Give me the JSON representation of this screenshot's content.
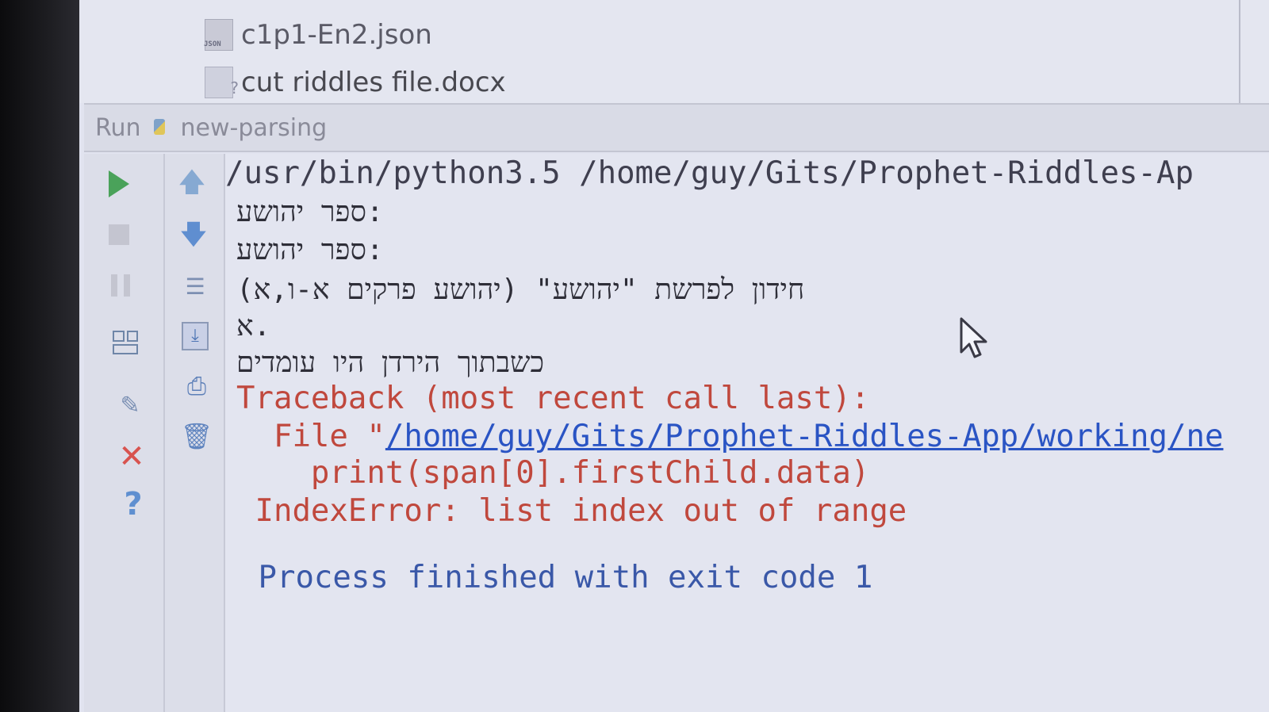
{
  "project_files": [
    {
      "icon": "json-file-icon",
      "name": "c1p1-En2.json"
    },
    {
      "icon": "docx-file-icon",
      "name": "cut riddles file.docx"
    }
  ],
  "run_panel": {
    "label": "Run",
    "config_name": "new-parsing"
  },
  "console": {
    "command": "/usr/bin/python3.5 /home/guy/Gits/Prophet-Riddles-Ap",
    "lines": [
      "ספר יהושע:",
      "ספר יהושע:",
      "חידון לפרשת \"יהושע\" (יהושע פרקים א-ו,א)",
      "א.",
      "כשבתוך הירדן היו עומדים"
    ],
    "traceback_header": "Traceback (most recent call last):",
    "file_prefix": "  File \"",
    "file_link": "/home/guy/Gits/Prophet-Riddles-App/working/ne",
    "code_line": "    print(span[0].firstChild.data)",
    "error": " IndexError: list index out of range",
    "exit_message": " Process finished with exit code 1"
  },
  "colors": {
    "error": "#c0483d",
    "link": "#2a54c4",
    "run_green": "#4aa25a",
    "close_red": "#d8534f"
  }
}
